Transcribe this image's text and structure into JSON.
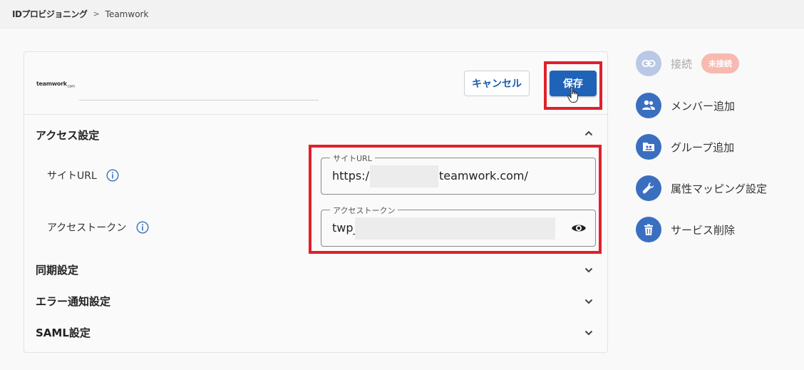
{
  "breadcrumb": {
    "root": "IDプロビジョニング",
    "separator": ">",
    "current": "Teamwork"
  },
  "card": {
    "logo_text": "teamwork",
    "logo_sub": ".com",
    "cancel_label": "キャンセル",
    "save_label": "保存"
  },
  "access_section": {
    "title": "アクセス設定",
    "site_url_label": "サイトURL",
    "site_url_field_label": "サイトURL",
    "site_url_prefix": "https:/",
    "site_url_suffix": "teamwork.com/",
    "token_label": "アクセストークン",
    "token_field_label": "アクセストークン",
    "token_prefix": "twp_"
  },
  "sections": {
    "sync": "同期設定",
    "error_notify": "エラー通知設定",
    "saml": "SAML設定"
  },
  "sidebar": {
    "connect": "接続",
    "connect_badge": "未接続",
    "add_member": "メンバー追加",
    "add_group": "グループ追加",
    "attribute_mapping": "属性マッピング設定",
    "delete_service": "サービス削除"
  },
  "colors": {
    "accent": "#1f63b8",
    "highlight": "#e0202a",
    "badge": "#f7b9b0"
  }
}
